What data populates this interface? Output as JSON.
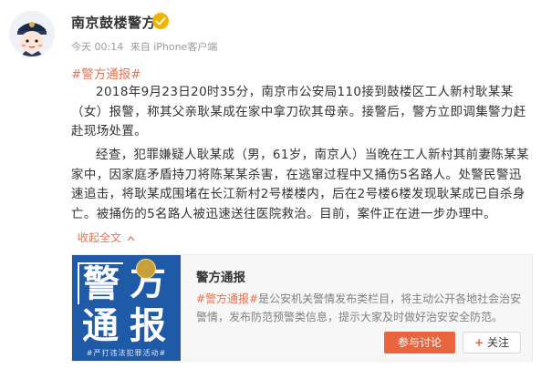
{
  "post": {
    "username": "南京鼓楼警方",
    "meta": {
      "time": "今天 00:14",
      "source": "来自 iPhone客户端"
    },
    "topic": "#警方通报#",
    "paragraph1": "2018年9月23日20时35分，南京市公安局110接到鼓楼区工人新村耿某某（女）报警，称其父亲耿某成在家中拿刀砍其母亲。接警后，警方立即调集警力赶赴现场处置。",
    "paragraph2": "经查，犯罪嫌疑人耿某成（男，61岁，南京人）当晚在工人新村其前妻陈某某家中，因家庭矛盾持刀将陈某某杀害，在逃窜过程中又捅伤5名路人。处警民警迅速追击，将耿某成围堵在长江新村2号楼楼内，后在2号楼6楼发现耿某成已自杀身亡。被捅伤的5名路人被迅速送往医院救治。目前，案件正在进一步办理中。",
    "collapse_label": "收起全文",
    "collapse_icon": "chevron-up-icon"
  },
  "card": {
    "image_text": [
      "警",
      "方",
      "通",
      "报"
    ],
    "slogan": "#严打违法犯罪活动#",
    "title": "警方通报",
    "desc_tag": "#警方通报#",
    "desc_text": "是公安机关警情发布类栏目，将主动公开各地社会治安警情，发布防范预警类信息，提示大家及时做好治安安全防范。",
    "join_label": "参与讨论",
    "follow_plus": "+",
    "follow_label": "关注"
  },
  "colors": {
    "accent": "#eb7350",
    "verified": "#f0b400",
    "card_image_bg": "#1f5aa8"
  }
}
